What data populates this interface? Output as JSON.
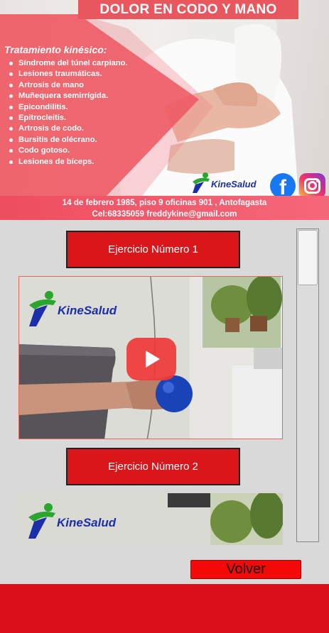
{
  "banner": {
    "title": "DOLOR EN CODO Y MANO",
    "treatment_title": "Tratamiento kinésico:",
    "treatments": [
      "Síndrome del túnel carpiano.",
      "Lesiones traumáticas.",
      "Artrosis de mano",
      "Muñequera semirrígida.",
      "Epicondilitis.",
      "Epitrocleitis.",
      "Artrosis de codo.",
      "Bursitis de olécrano.",
      "Codo gotoso.",
      "Lesiones de bíceps."
    ],
    "logo_text": "KineSalud",
    "facebook_icon": "facebook-icon",
    "instagram_icon": "instagram-icon",
    "contact_line1": "14 de febrero 1985, piso 9 oficinas 901 , Antofagasta",
    "contact_line2": "Cel:68335059 freddykine@gmail.com"
  },
  "exercises": [
    {
      "label": "Ejercicio Número 1",
      "video_logo": "KineSalud"
    },
    {
      "label": "Ejercicio Número 2",
      "video_logo": "KineSalud"
    }
  ],
  "actions": {
    "back_label": "Volver"
  },
  "colors": {
    "accent_red": "#d9171b",
    "banner_pink": "#ee4e5f",
    "footer_red": "#d90f1a"
  }
}
